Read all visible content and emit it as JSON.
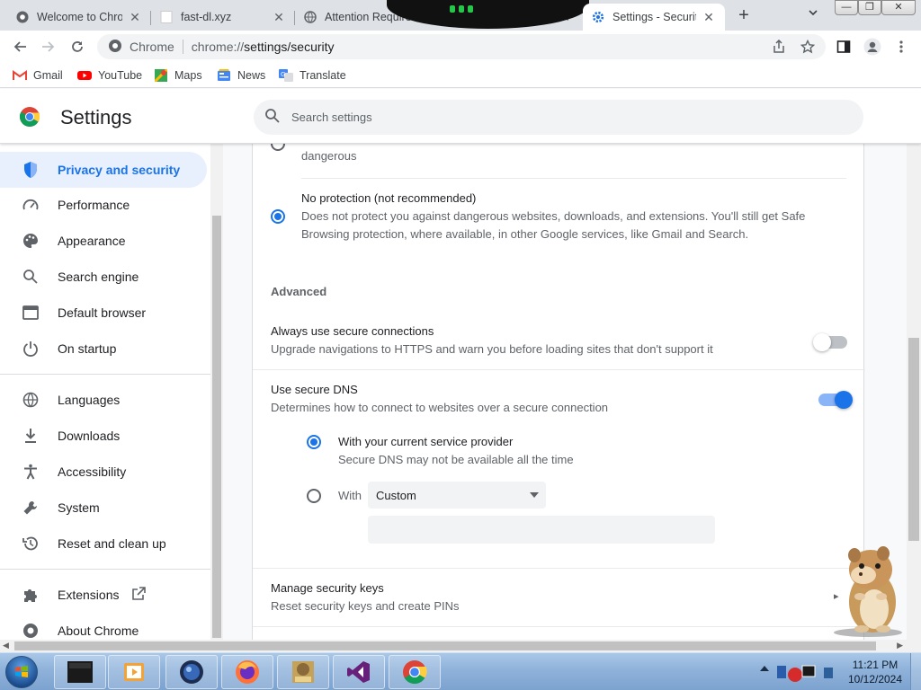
{
  "browser": {
    "tabs": [
      {
        "title": "Welcome to Chrome",
        "favicon": "chrome-icon",
        "active": false
      },
      {
        "title": "fast-dl.xyz",
        "favicon": "blank-page-icon",
        "active": false
      },
      {
        "title": "Attention Required",
        "favicon": "globe-icon",
        "active": false
      },
      {
        "title": "Settings - Security",
        "favicon": "gear-icon",
        "active": true
      }
    ],
    "new_tab": "+",
    "address": {
      "site_label": "Chrome",
      "url_scheme": "chrome://",
      "url_path": "settings/security"
    },
    "bookmarks": [
      {
        "label": "Gmail",
        "icon": "gmail-icon"
      },
      {
        "label": "YouTube",
        "icon": "youtube-icon"
      },
      {
        "label": "Maps",
        "icon": "maps-icon"
      },
      {
        "label": "News",
        "icon": "news-icon"
      },
      {
        "label": "Translate",
        "icon": "translate-icon"
      }
    ]
  },
  "settings": {
    "title": "Settings",
    "search_placeholder": "Search settings",
    "nav": [
      {
        "label": "Privacy and security",
        "icon": "shield-icon",
        "active": true
      },
      {
        "label": "Performance",
        "icon": "speedometer-icon"
      },
      {
        "label": "Appearance",
        "icon": "palette-icon"
      },
      {
        "label": "Search engine",
        "icon": "search-icon"
      },
      {
        "label": "Default browser",
        "icon": "browser-window-icon"
      },
      {
        "label": "On startup",
        "icon": "power-icon"
      },
      {
        "label": "Languages",
        "icon": "globe-icon"
      },
      {
        "label": "Downloads",
        "icon": "download-icon"
      },
      {
        "label": "Accessibility",
        "icon": "accessibility-icon"
      },
      {
        "label": "System",
        "icon": "wrench-icon"
      },
      {
        "label": "Reset and clean up",
        "icon": "history-icon"
      },
      {
        "label": "Extensions",
        "icon": "puzzle-icon"
      },
      {
        "label": "About Chrome",
        "icon": "chrome-icon"
      }
    ],
    "content": {
      "standard_tail": "dangerous",
      "no_protection": {
        "title": "No protection (not recommended)",
        "desc_line1": "Does not protect you against dangerous websites, downloads, and extensions. You'll still get Safe",
        "desc_line2": "Browsing protection, where available, in other Google services, like Gmail and Search.",
        "selected": true
      },
      "advanced_heading": "Advanced",
      "https": {
        "title": "Always use secure connections",
        "desc": "Upgrade navigations to HTTPS and warn you before loading sites that don't support it",
        "enabled": false
      },
      "secure_dns": {
        "title": "Use secure DNS",
        "desc": "Determines how to connect to websites over a secure connection",
        "enabled": true,
        "option_current": {
          "title": "With your current service provider",
          "desc": "Secure DNS may not be available all the time",
          "selected": true
        },
        "option_with": {
          "label": "With",
          "select_value": "Custom",
          "selected": false
        }
      },
      "security_keys": {
        "title": "Manage security keys",
        "desc": "Reset security keys and create PINs"
      }
    }
  },
  "taskbar": {
    "time": "11:21 PM",
    "date": "10/12/2024",
    "apps": [
      "media-player-icon",
      "firefox-icon",
      "box-game-icon",
      "visual-studio-icon",
      "chrome-icon"
    ]
  },
  "colors": {
    "accent": "#1a73e8",
    "active_nav_bg": "#e8f0fe",
    "tabstrip_bg": "#dee1e6",
    "taskbar": "#8fb2da"
  }
}
